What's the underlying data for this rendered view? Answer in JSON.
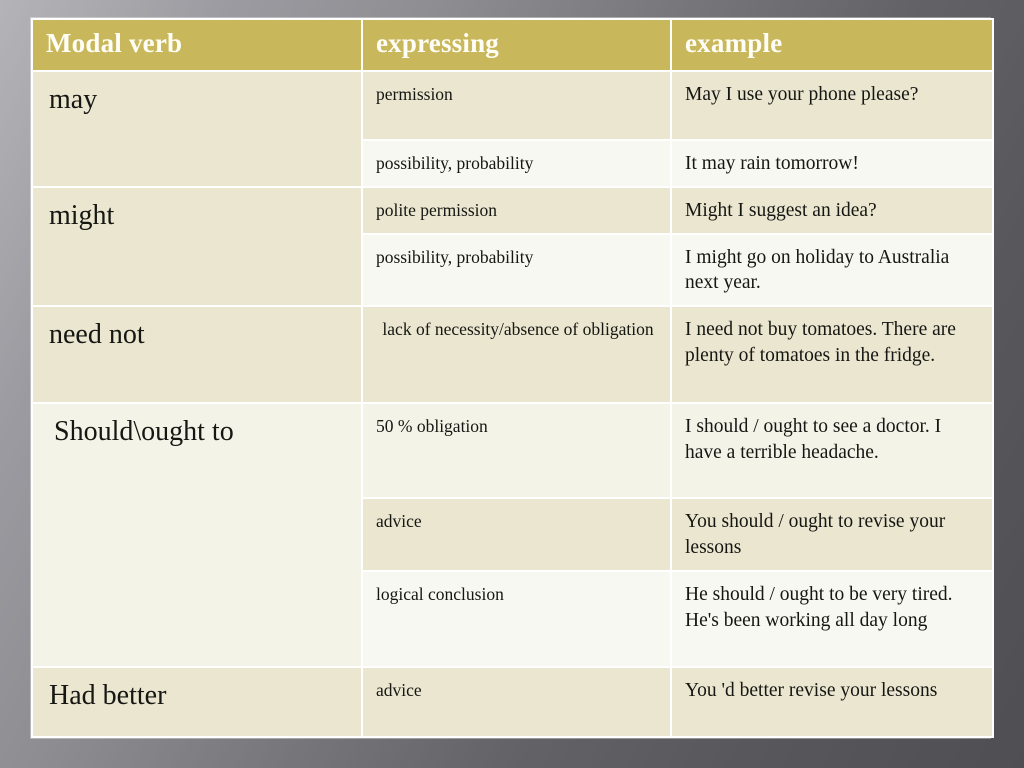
{
  "slide": {
    "title_row": {
      "col1": "Modal verb",
      "col2": "expressing",
      "col3": "example"
    },
    "colors": {
      "header_bg": "#c9b75b",
      "header_text": "#fffef6",
      "row_dark": "#eae6d0",
      "row_light": "#f8f8f2",
      "row_pale": "#f4f3e8",
      "text": "#161612",
      "backdrop_light": "#b4b4b8",
      "backdrop_dark": "#4f4f53"
    }
  },
  "rows": [
    {
      "verb": "may",
      "entries": [
        {
          "expressing": "permission",
          "example": "May I use your phone please?"
        },
        {
          "expressing": "possibility, probability",
          "example": "It may rain tomorrow!"
        }
      ]
    },
    {
      "verb": "might",
      "entries": [
        {
          "expressing": "polite permission",
          "example": "Might I suggest an idea?"
        },
        {
          "expressing": "possibility, probability",
          "example": "I might go on holiday to Australia next year."
        }
      ]
    },
    {
      "verb": "need not",
      "entries": [
        {
          "expressing": "lack of necessity/absence of obligation",
          "example": "I need not buy tomatoes. There are plenty of tomatoes in the fridge."
        }
      ]
    },
    {
      "verb": "Should\\ought to",
      "entries": [
        {
          "expressing": "50 % obligation",
          "example": "I should / ought to see a doctor. I have a terrible headache."
        },
        {
          "expressing": "advice",
          "example": "You should / ought to revise your lessons"
        },
        {
          "expressing": "logical conclusion",
          "example": "He should / ought to be very tired. He's been working all day long"
        }
      ]
    },
    {
      "verb": "Had better",
      "entries": [
        {
          "expressing": "advice",
          "example": "You 'd better revise your lessons"
        }
      ]
    }
  ]
}
